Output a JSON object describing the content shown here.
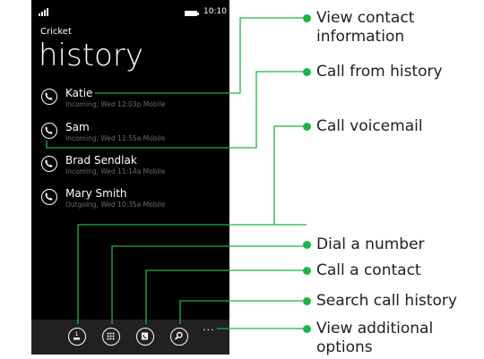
{
  "status_bar": {
    "time": "10:10"
  },
  "app": {
    "name": "Cricket",
    "title": "history"
  },
  "calls": [
    {
      "name": "Katie",
      "detail": "Incoming, Wed 12:03p Mobile"
    },
    {
      "name": "Sam",
      "detail": "Incoming, Wed 11:55a Mobile"
    },
    {
      "name": "Brad Sendlak",
      "detail": "Incoming, Wed 11:14a Mobile"
    },
    {
      "name": "Mary Smith",
      "detail": "Outgoing, Wed 10:35a Mobile"
    }
  ],
  "app_bar": {
    "more": "..."
  },
  "callouts": {
    "view_contact_line1": "View contact",
    "view_contact_line2": "information",
    "call_from_history": "Call from history",
    "call_voicemail": "Call voicemail",
    "dial_number": "Dial a number",
    "call_contact": "Call a contact",
    "search_history": "Search call history",
    "view_options_line1": "View additional",
    "view_options_line2": "options"
  },
  "colors": {
    "callout_green": "#21b14b",
    "screen_bg": "#000000",
    "app_bar_bg": "#212121"
  }
}
